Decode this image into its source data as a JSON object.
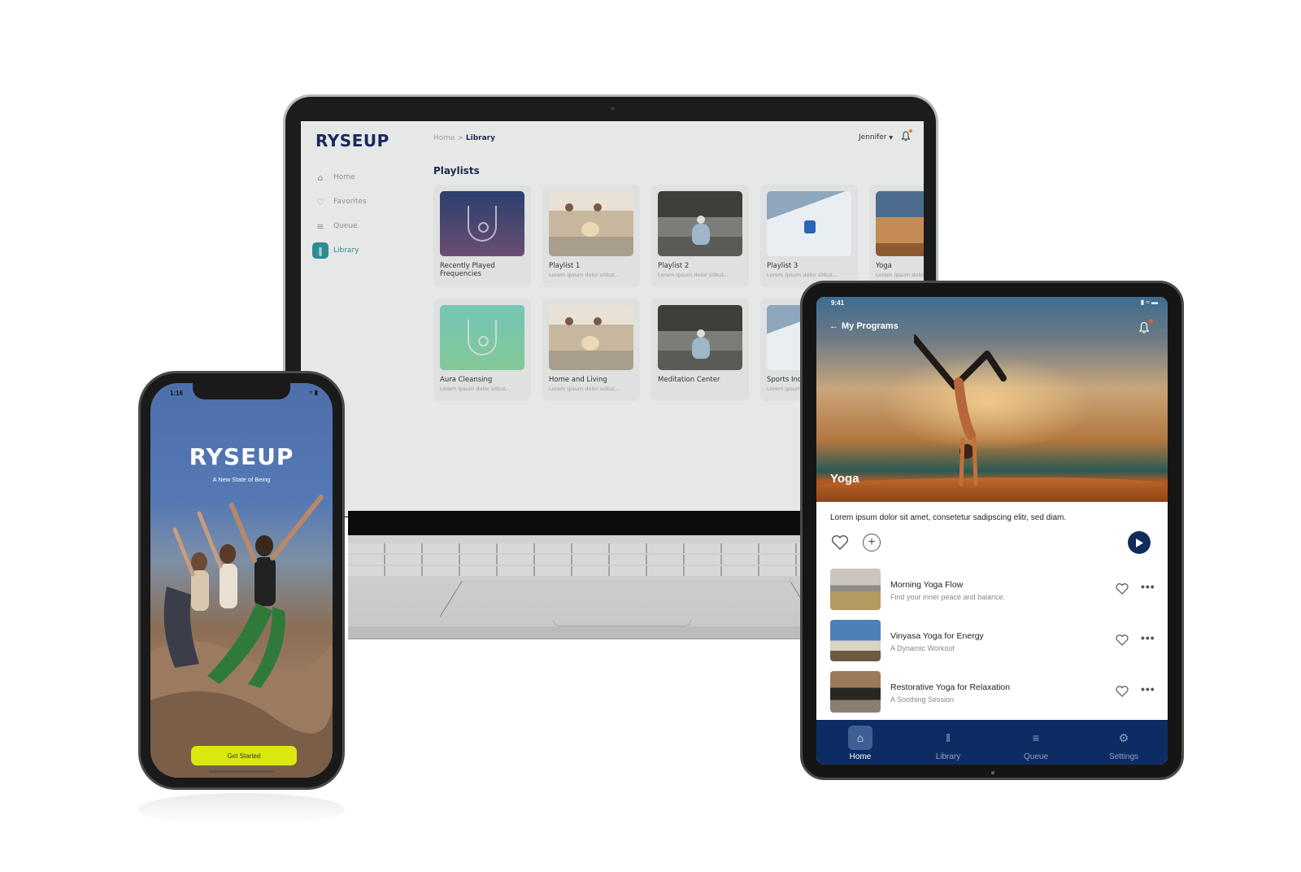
{
  "laptop": {
    "logo": "RYSEUP",
    "breadcrumb": {
      "home": "Home",
      "separator": ">",
      "current": "Library"
    },
    "user": {
      "name": "Jennifer",
      "dropdown_icon": "caret-down-icon",
      "notification_icon": "bell-icon"
    },
    "nav": [
      {
        "label": "Home",
        "icon": "home-icon",
        "active": false
      },
      {
        "label": "Favorites",
        "icon": "heart-icon",
        "active": false
      },
      {
        "label": "Queue",
        "icon": "queue-icon",
        "active": false
      },
      {
        "label": "Library",
        "icon": "library-icon",
        "active": true
      }
    ],
    "section_title": "Playlists",
    "playlists": [
      {
        "title": "Recently Played Frequencies",
        "subtitle": ""
      },
      {
        "title": "Playlist 1",
        "subtitle": "Lorem ipsum dolor sitkut..."
      },
      {
        "title": "Playlist 2",
        "subtitle": "Lorem ipsum dolor sitkut..."
      },
      {
        "title": "Playlist 3",
        "subtitle": "Lorem ipsum dolor sitkut..."
      },
      {
        "title": "Yoga",
        "subtitle": "Lorem ipsum dolor sitkut..."
      },
      {
        "title": "Aura Cleansing",
        "subtitle": "Lorem ipsum dolor sitkut..."
      },
      {
        "title": "Home and Living",
        "subtitle": "Lorem ipsum dolor sitkut..."
      },
      {
        "title": "Meditation Center",
        "subtitle": ""
      },
      {
        "title": "Sports Industry",
        "subtitle": "Lorem ipsum dolor sitkut..."
      }
    ]
  },
  "phone": {
    "time": "1:16",
    "logo": "RYSEUP",
    "tagline": "A New State of Being",
    "cta_label": "Get Started",
    "cta_color": "#dbe80f"
  },
  "tablet": {
    "time": "9:41",
    "back_label": "My Programs",
    "hero_title": "Yoga",
    "description": "Lorem ipsum dolor sit amet, consetetur sadipscing elitr, sed diam.",
    "items": [
      {
        "title": "Morning Yoga Flow",
        "subtitle": "Find your inner peace and balance."
      },
      {
        "title": "Vinyasa Yoga for Energy",
        "subtitle": "A Dynamic Workout"
      },
      {
        "title": "Restorative Yoga for Relaxation",
        "subtitle": "A Soothing Session"
      }
    ],
    "more_label": "•••",
    "bottom_nav": [
      {
        "label": "Home",
        "icon": "home-icon",
        "active": true
      },
      {
        "label": "Library",
        "icon": "library-icon",
        "active": false
      },
      {
        "label": "Queue",
        "icon": "queue-icon",
        "active": false
      },
      {
        "label": "Settings",
        "icon": "gear-icon",
        "active": false
      }
    ],
    "nav_color": "#0d2c64",
    "play_color": "#0f2c5c"
  }
}
